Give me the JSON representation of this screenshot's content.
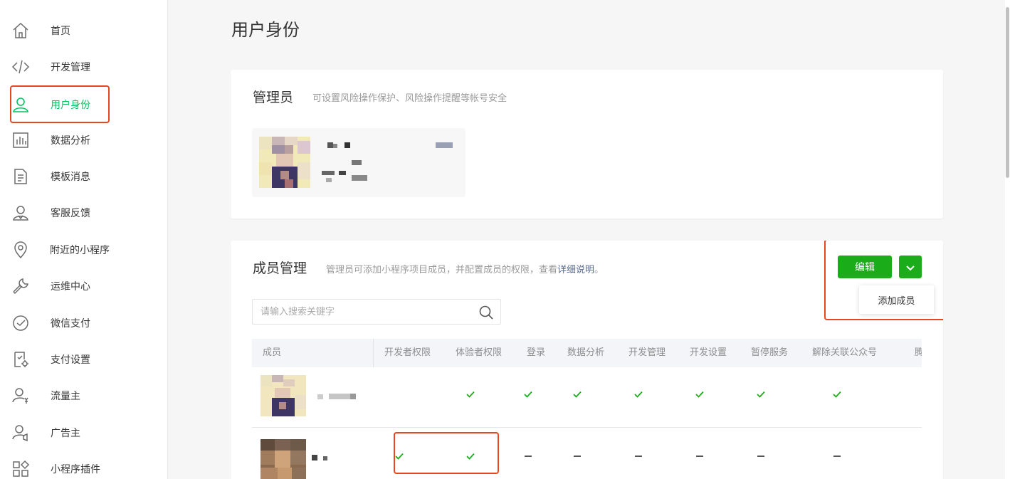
{
  "sidebar": {
    "items": [
      {
        "label": "首页",
        "icon": "home-icon"
      },
      {
        "label": "开发管理",
        "icon": "code-icon"
      },
      {
        "label": "用户身份",
        "icon": "user-icon",
        "active": true
      },
      {
        "label": "数据分析",
        "icon": "chart-icon"
      },
      {
        "label": "模板消息",
        "icon": "document-icon"
      },
      {
        "label": "客服反馈",
        "icon": "customer-service-icon"
      },
      {
        "label": "附近的小程序",
        "icon": "location-icon"
      },
      {
        "label": "运维中心",
        "icon": "wrench-icon"
      },
      {
        "label": "微信支付",
        "icon": "wechat-pay-icon"
      },
      {
        "label": "支付设置",
        "icon": "payment-settings-icon"
      },
      {
        "label": "流量主",
        "icon": "traffic-master-icon"
      },
      {
        "label": "广告主",
        "icon": "advertiser-icon"
      },
      {
        "label": "小程序插件",
        "icon": "plugin-icon"
      }
    ]
  },
  "page": {
    "title": "用户身份"
  },
  "admin": {
    "title": "管理员",
    "desc": "可设置风险操作保护、风险操作提醒等帐号安全"
  },
  "members": {
    "title": "成员管理",
    "desc_prefix": "管理员可添加小程序项目成员，并配置成员的权限，查看",
    "desc_link": "详细说明",
    "desc_suffix": "。",
    "edit_label": "编辑",
    "add_member_label": "添加成员",
    "search_placeholder": "请输入搜索关键字",
    "columns": [
      "成员",
      "开发者权限",
      "体验者权限",
      "登录",
      "数据分析",
      "开发管理",
      "开发设置",
      "暂停服务",
      "解除关联公众号",
      "腾讯"
    ],
    "rows": [
      {
        "marks": [
          "",
          "check",
          "check",
          "check",
          "check",
          "check",
          "check",
          "check"
        ]
      },
      {
        "marks": [
          "check",
          "check",
          "dash",
          "dash",
          "dash",
          "dash",
          "dash",
          "dash"
        ]
      }
    ]
  },
  "colors": {
    "accent": "#07c160",
    "button": "#1aad19",
    "highlight": "#e8461f",
    "link": "#576b95"
  }
}
